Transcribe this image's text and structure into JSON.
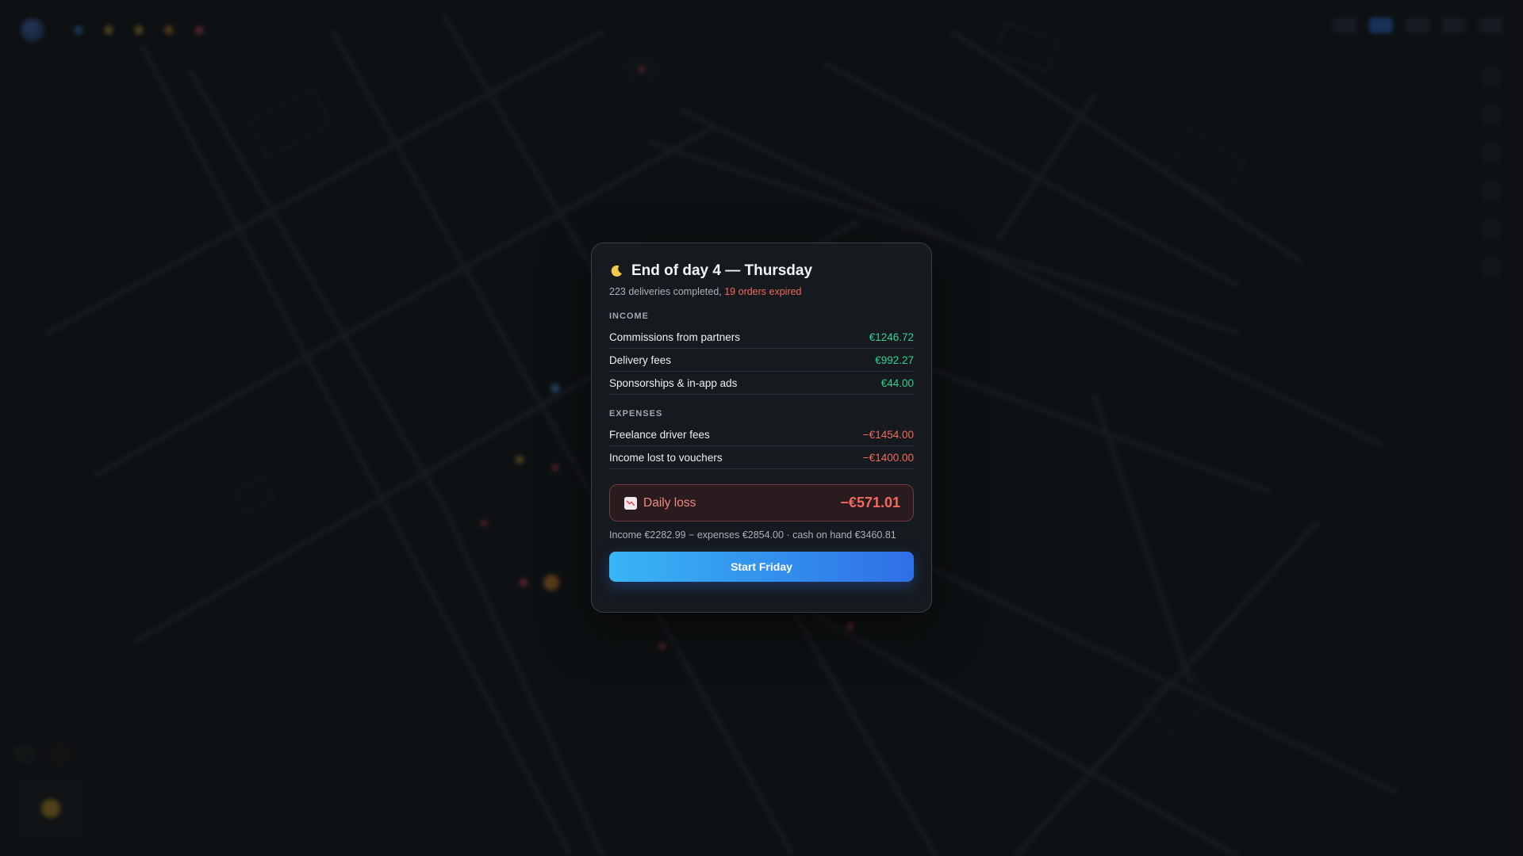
{
  "modal": {
    "title": "End of day 4 — Thursday",
    "subtitle_prefix": "223 deliveries completed, ",
    "subtitle_expired": "19 orders expired",
    "income_label": "INCOME",
    "income": [
      {
        "label": "Commissions from partners",
        "amount": "€1246.72"
      },
      {
        "label": "Delivery fees",
        "amount": "€992.27"
      },
      {
        "label": "Sponsorships & in-app ads",
        "amount": "€44.00"
      }
    ],
    "expenses_label": "EXPENSES",
    "expenses": [
      {
        "label": "Freelance driver fees",
        "amount": "−€1454.00"
      },
      {
        "label": "Income lost to vouchers",
        "amount": "−€1400.00"
      }
    ],
    "result_label": "Daily loss",
    "result_amount": "−€571.01",
    "summary": "Income €2282.99 − expenses €2854.00 · cash on hand €3460.81",
    "button_label": "Start Friday"
  },
  "colors": {
    "positive": "#33d28e",
    "negative": "#f06a5f",
    "accent_start": "#38b6f5",
    "accent_end": "#2f6fe6"
  },
  "icons": [
    "moon-icon",
    "chart-down-icon"
  ]
}
